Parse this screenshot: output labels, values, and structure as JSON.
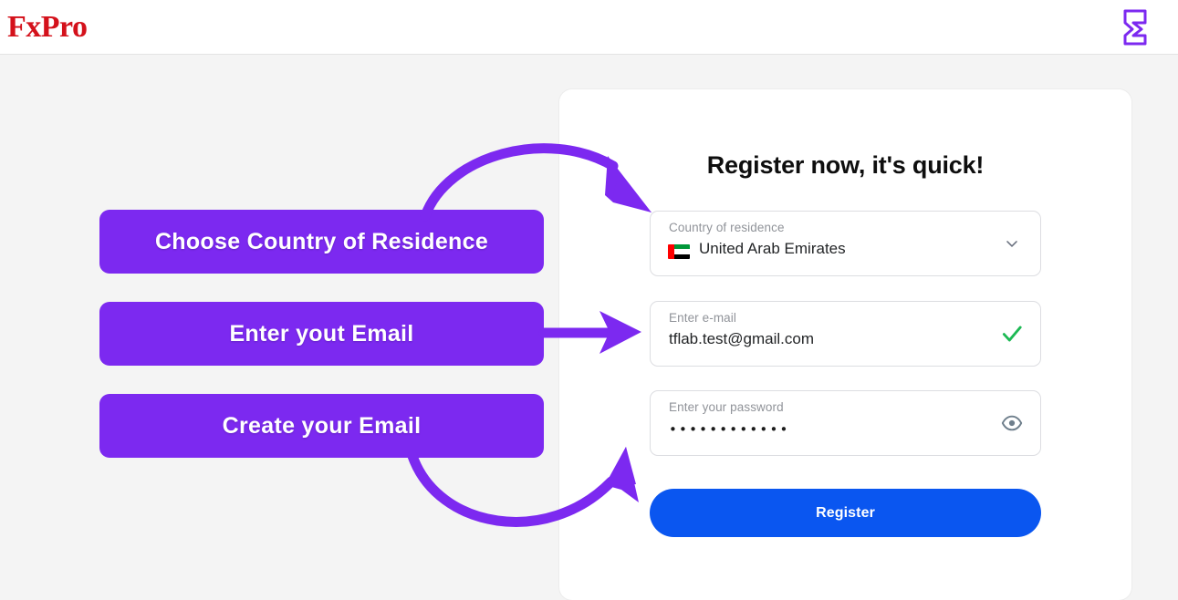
{
  "header": {
    "brand": "FxPro",
    "logo_icon": "fxpro-mark-icon"
  },
  "card": {
    "title": "Register now, it's quick!",
    "fields": [
      {
        "name": "country",
        "label": "Country of residence",
        "value": "United Arab Emirates",
        "flag": "united-arab-emirates-flag",
        "icon": "chevron-down-icon"
      },
      {
        "name": "email",
        "label": "Enter e-mail",
        "value": "tflab.test@gmail.com",
        "icon": "check-valid-icon"
      },
      {
        "name": "password",
        "label": "Enter your password",
        "value": "••••••••••••",
        "icon": "eye-show-password-icon"
      }
    ],
    "submit_label": "Register"
  },
  "annotations": {
    "callouts": [
      {
        "label": "Choose Country of Residence",
        "arrow": "curved-arrow-down-right"
      },
      {
        "label": "Enter yout Email",
        "arrow": "straight-arrow-right"
      },
      {
        "label": "Create your Email",
        "arrow": "curved-arrow-up-right"
      }
    ]
  },
  "colors": {
    "brand_red": "#d4111b",
    "annotation_purple": "#7c29f0",
    "submit_blue": "#0a56f0",
    "valid_green": "#1db954",
    "page_background": "#f4f4f4"
  }
}
